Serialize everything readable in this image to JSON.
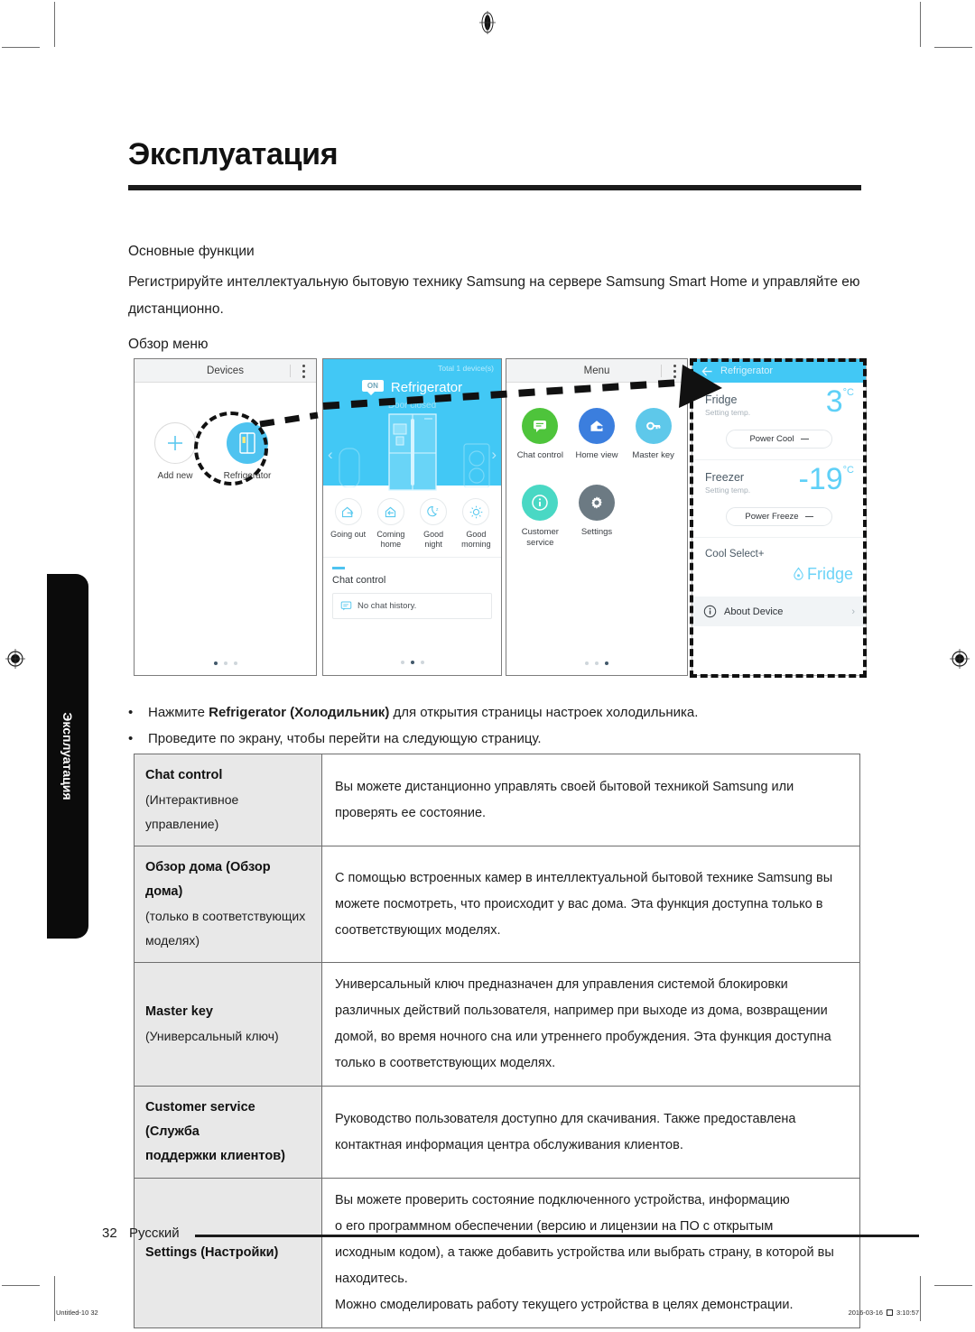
{
  "document": {
    "chapter_title": "Эксплуатация",
    "side_tab_label": "Эксплуатация",
    "intro_heading": "Основные функции",
    "intro_paragraph": "Регистрируйте интеллектуальную бытовую технику Samsung на сервере Samsung Smart Home и управляйте ею дистанционно.",
    "menu_overview_label": "Обзор меню"
  },
  "screens": {
    "devices": {
      "title": "Devices",
      "add_new_label": "Add new",
      "refrigerator_label": "Refrigerator",
      "page_dots": [
        "on",
        "off",
        "off"
      ]
    },
    "home": {
      "total_devices": "Total 1 device(s)",
      "power_badge": "ON",
      "device_name": "Refrigerator",
      "device_status": "Door closed",
      "quick_actions": [
        {
          "label_line1": "Going out",
          "label_line2": "",
          "icon": "house-exit-icon"
        },
        {
          "label_line1": "Coming",
          "label_line2": "home",
          "icon": "house-enter-icon"
        },
        {
          "label_line1": "Good",
          "label_line2": "night",
          "icon": "moon-icon"
        },
        {
          "label_line1": "Good",
          "label_line2": "morning",
          "icon": "sun-icon"
        }
      ],
      "chat_section_title": "Chat control",
      "chat_empty_text": "No chat history.",
      "page_dots": [
        "off",
        "on",
        "off"
      ]
    },
    "menu": {
      "title": "Menu",
      "items": [
        {
          "label_line1": "Chat control",
          "label_line2": "",
          "icon": "chat-bubble-icon",
          "color": "#4ec43b"
        },
        {
          "label_line1": "Home view",
          "label_line2": "",
          "icon": "home-camera-icon",
          "color": "#3b7ede"
        },
        {
          "label_line1": "Master key",
          "label_line2": "",
          "icon": "key-icon",
          "color": "#5ec8ea"
        },
        {
          "label_line1": "Customer",
          "label_line2": "service",
          "icon": "info-icon",
          "color": "#49d8c4"
        },
        {
          "label_line1": "Settings",
          "label_line2": "",
          "icon": "gear-icon",
          "color": "#6c7a83"
        }
      ],
      "page_dots": [
        "off",
        "off",
        "on"
      ]
    },
    "refrigerator": {
      "title": "Refrigerator",
      "back_icon": "arrow-left-icon",
      "fridge": {
        "name": "Fridge",
        "sub": "Setting temp.",
        "value": "3",
        "unit": "°C",
        "button": "Power Cool"
      },
      "freezer": {
        "name": "Freezer",
        "sub": "Setting temp.",
        "value": "-19",
        "unit": "°C",
        "button": "Power Freeze"
      },
      "cool_select": {
        "title": "Cool Select+",
        "value": "Fridge"
      },
      "about_device": "About Device"
    }
  },
  "bullets": [
    {
      "pre": "Нажмите ",
      "bold": "Refrigerator (Холодильник)",
      "post": " для открытия страницы настроек холодильника."
    },
    {
      "pre": "",
      "bold": "",
      "post": "Проведите по экрану, чтобы перейти на следующую страницу."
    }
  ],
  "table": {
    "rows": [
      {
        "key_main": "Chat control",
        "key_sub_lines": [
          "(Интерактивное",
          "управление)"
        ],
        "value_lines": [
          "Вы можете дистанционно управлять своей бытовой техникой Samsung или",
          "проверять ее состояние."
        ]
      },
      {
        "key_main": "Обзор дома (Обзор дома)",
        "key_sub_lines": [
          "(только в соответствующих",
          "моделях)"
        ],
        "value_lines": [
          "С помощью встроенных камер в интеллектуальной бытовой технике Samsung вы",
          "можете посмотреть, что происходит у вас дома. Эта функция доступна только в",
          "соответствующих моделях."
        ]
      },
      {
        "key_main": "Master key",
        "key_sub_lines": [
          "(Универсальный ключ)"
        ],
        "value_lines": [
          "Универсальный ключ предназначен для управления системой блокировки",
          "различных действий пользователя, например при выходе из дома, возвращении",
          "домой, во время ночного сна или утреннего пробуждения. Эта функция доступна",
          "только в соответствующих моделях."
        ]
      },
      {
        "key_main": "Customer service (Служба",
        "key_sub_lines": [
          "поддержки клиентов)"
        ],
        "value_lines": [
          "Руководство пользователя доступно для скачивания. Также предоставлена",
          "контактная информация центра обслуживания клиентов."
        ]
      },
      {
        "key_main": "Settings (Настройки)",
        "key_sub_lines": [],
        "value_lines": [
          "Вы можете проверить состояние подключенного устройства, информацию",
          "о его программном обеспечении (версию и лицензии на ПО с открытым",
          "исходным кодом), а также добавить устройства или выбрать страну, в которой вы",
          "находитесь.",
          "Можно смоделировать работу текущего устройства в целях демонстрации."
        ]
      }
    ]
  },
  "footer": {
    "page_number": "32",
    "language": "Русский",
    "meta_left": "Untitled-10   32",
    "meta_right_date": "2016-03-16",
    "meta_right_time": "3:10:57"
  },
  "colors": {
    "accent_cyan": "#42c8f5",
    "title_rule": "#1b1b1b",
    "table_key_bg": "#e8e8e8"
  }
}
